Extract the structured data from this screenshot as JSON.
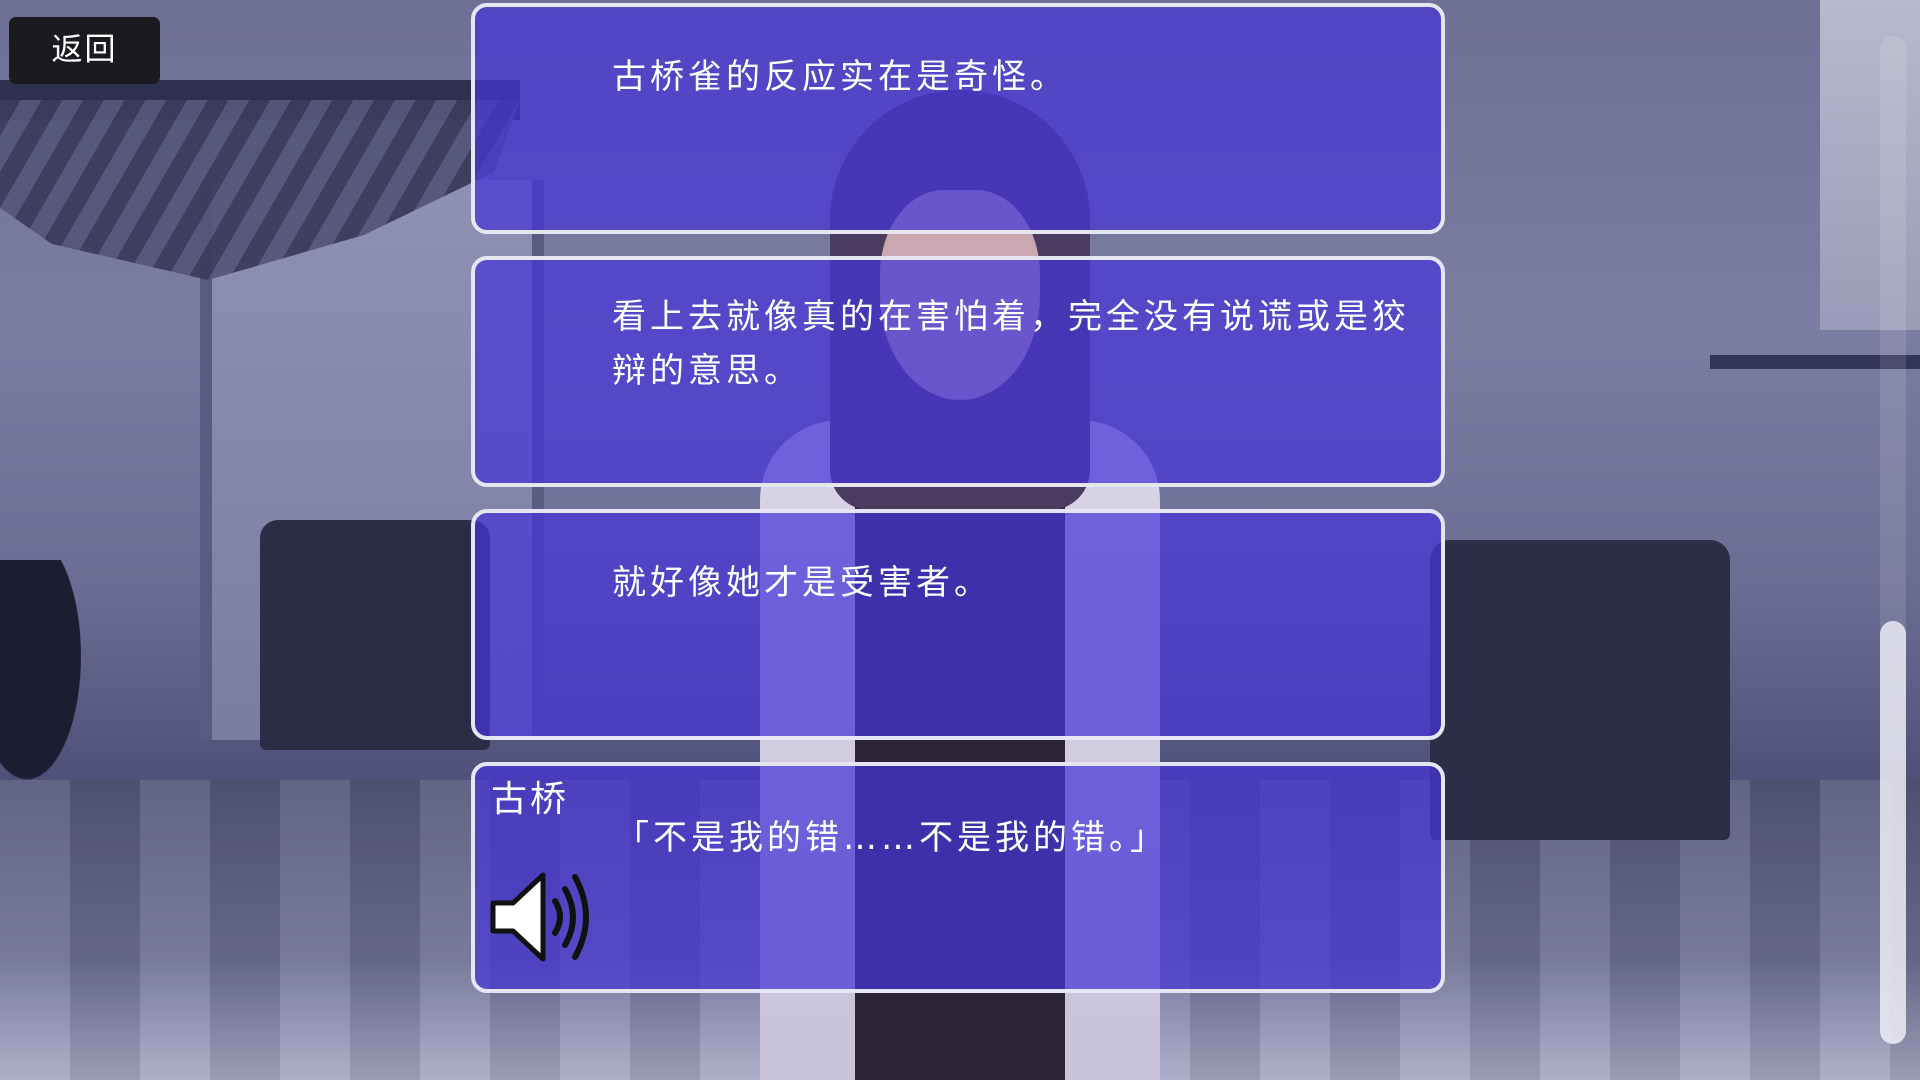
{
  "nav": {
    "back_label": "返回"
  },
  "log": {
    "entries": [
      {
        "speaker": "",
        "text": "古桥雀的反应实在是奇怪。"
      },
      {
        "speaker": "",
        "text": "看上去就像真的在害怕着，完全没有说谎或是狡辩的意思。"
      },
      {
        "speaker": "",
        "text": "就好像她才是受害者。"
      },
      {
        "speaker": "古桥",
        "text": "「不是我的错……不是我的错。」",
        "has_voice": true
      }
    ]
  },
  "icons": {
    "voice": "speaker-icon"
  },
  "colors": {
    "panel_fill": "#4634d7",
    "panel_border": "#e6e6f2",
    "back_button_bg": "#1b1b1f"
  },
  "scroll": {
    "position_fraction": 1.0
  }
}
